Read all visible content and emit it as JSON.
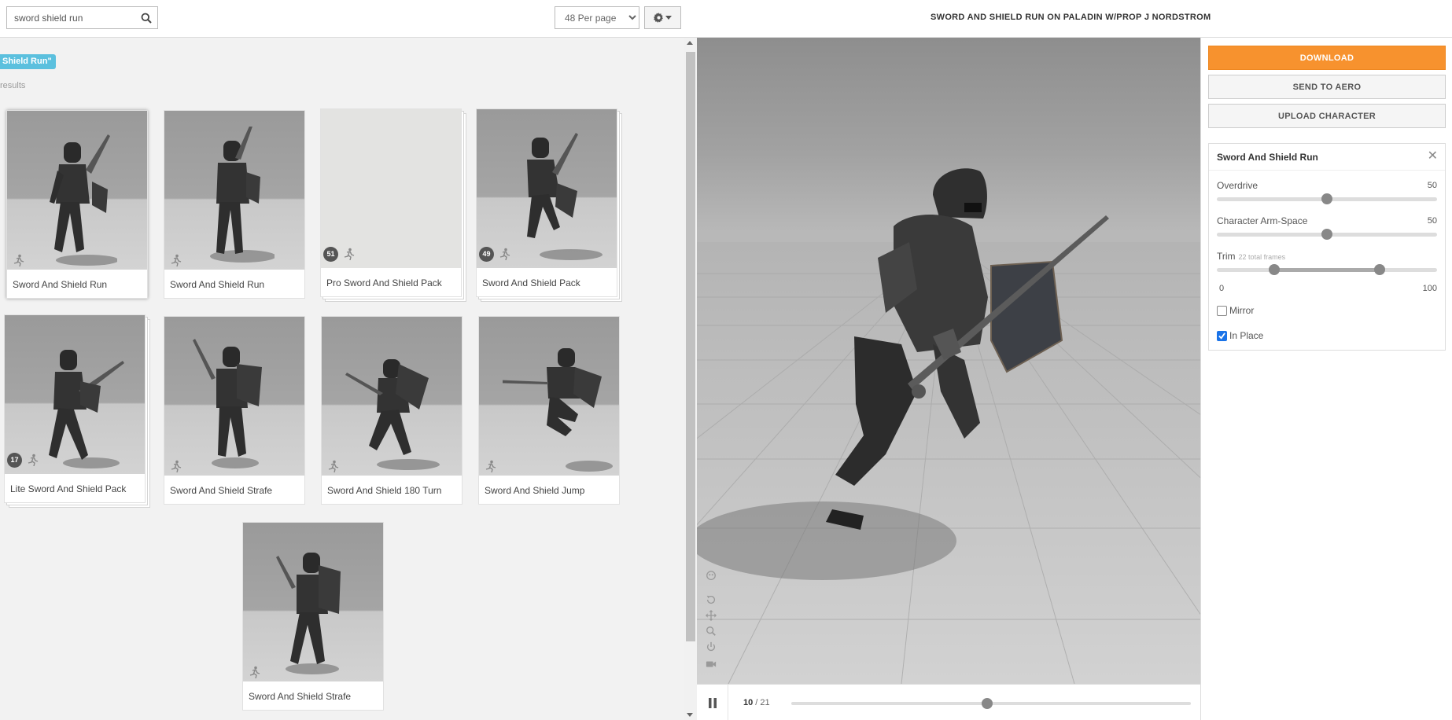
{
  "search": {
    "value": "sword shield run"
  },
  "per_page": {
    "selected": "48 Per page"
  },
  "filter_tag": "Shield Run\"",
  "results_count": "results",
  "cards": [
    {
      "label": "Sword And Shield Run",
      "pack_count": null
    },
    {
      "label": "Sword And Shield Run",
      "pack_count": null
    },
    {
      "label": "Pro Sword And Shield Pack",
      "pack_count": "51"
    },
    {
      "label": "Sword And Shield Pack",
      "pack_count": "49"
    },
    {
      "label": "Lite Sword And Shield Pack",
      "pack_count": "17"
    },
    {
      "label": "Sword And Shield Strafe",
      "pack_count": null
    },
    {
      "label": "Sword And Shield 180 Turn",
      "pack_count": null
    },
    {
      "label": "Sword And Shield Jump",
      "pack_count": null
    },
    {
      "label": "Sword And Shield Strafe",
      "pack_count": null
    }
  ],
  "viewer": {
    "title": "SWORD AND SHIELD RUN ON PALADIN W/PROP J NORDSTROM",
    "frame_current": "10",
    "frame_total": " / 21",
    "progress": 0.49
  },
  "actions": {
    "download": "DOWNLOAD",
    "send_to_aero": "SEND TO AERO",
    "upload_character": "UPLOAD CHARACTER"
  },
  "settings": {
    "title": "Sword And Shield Run",
    "overdrive": {
      "label": "Overdrive",
      "value": "50",
      "fraction": 0.5
    },
    "arm_space": {
      "label": "Character Arm-Space",
      "value": "50",
      "fraction": 0.5
    },
    "trim": {
      "label": "Trim",
      "sublabel": "22 total frames",
      "min_label": "0",
      "max_label": "100",
      "start_fraction": 0.26,
      "end_fraction": 0.74
    },
    "mirror": {
      "label": "Mirror",
      "checked": false
    },
    "in_place": {
      "label": "In Place",
      "checked": true
    }
  },
  "colors": {
    "accent": "#f7922e",
    "tag": "#5bc0de",
    "checkbox": "#1a73e8"
  },
  "icons": [
    "search-icon",
    "gear-icon",
    "caret-down-icon",
    "running-icon",
    "close-icon",
    "pause-icon",
    "skeleton-icon",
    "rotate-icon",
    "move-icon",
    "zoom-icon",
    "power-icon",
    "camera-icon"
  ]
}
